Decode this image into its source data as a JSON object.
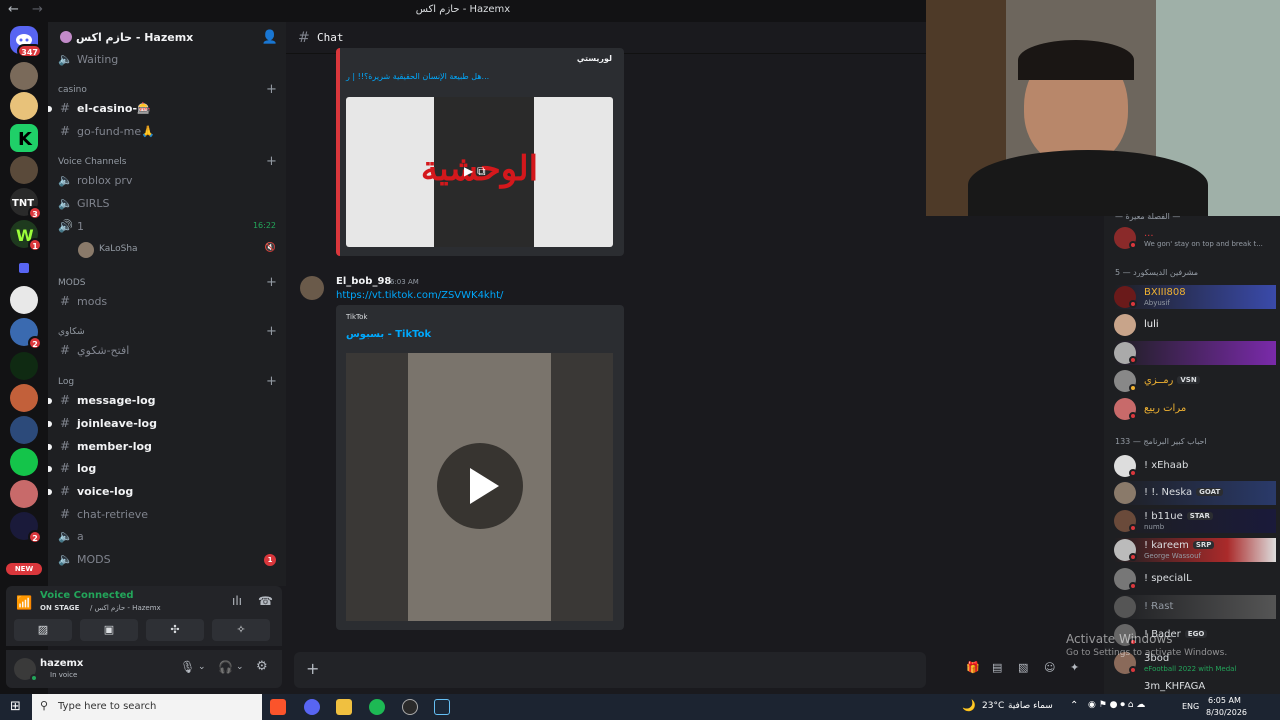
{
  "window": {
    "title": "حازم اكس - Hazemx"
  },
  "rail": {
    "home_badge": "347",
    "new_label": "NEW",
    "badges": [
      "3",
      "1",
      "2",
      "2"
    ]
  },
  "server": {
    "name": "حازم اكس - Hazemx"
  },
  "channels": {
    "waiting": "Waiting",
    "cat_casino": "casino",
    "el_casino": "el-casino-🎰",
    "go_fund": "go-fund-me🙏",
    "cat_voice": "Voice Channels",
    "roblox": "roblox prv",
    "girls": "GIRLS",
    "one": "1",
    "one_time": "16:22",
    "voice_user": "KaLoSha",
    "cat_mods": "MODS",
    "mods": "mods",
    "cat_shakawi": "شكاوي",
    "shakawi": "افتح-شكوي",
    "cat_log": "Log",
    "message_log": "message-log",
    "joinleave_log": "joinleave-log",
    "member_log": "member-log",
    "log": "log",
    "voice_log": "voice-log",
    "chat_retrieve": "chat-retrieve",
    "a": "a",
    "mods_voice": "MODS",
    "mods_voice_badge": "1"
  },
  "voice": {
    "status": "Voice Connected",
    "stage": "ON STAGE",
    "where": "/ حازم اكس - Hazemx"
  },
  "user": {
    "name": "hazemx",
    "status": "In voice"
  },
  "chat": {
    "channel": "Chat",
    "embed1": {
      "author": "لوريستي",
      "title": "هل طبيعة الإنسان الحقيقية شريرة؟!! | ر...",
      "thumb_text": "الوحشية"
    },
    "msg2": {
      "author": "El_bob_98",
      "time": "6:03 AM",
      "link": "https://vt.tiktok.com/ZSVWK4kht/",
      "provider": "TikTok",
      "title": "بسبوس - TikTok"
    }
  },
  "members": {
    "group1": "— الفصلة معيرة —",
    "m0": {
      "name": "...",
      "sub": "We gon' stay on top and break t..."
    },
    "group2": "مشرفين الديسكورد — 5",
    "m1": {
      "name": "BXIII808",
      "sub": "Abyusif"
    },
    "m2": {
      "name": "luli"
    },
    "m3": {
      "name": ""
    },
    "m4": {
      "name": "رمــزي",
      "tag": "VSN"
    },
    "m5": {
      "name": "مرات رييع"
    },
    "group3": "احباب كبير البرنامج — 133",
    "m6": {
      "name": "! xEhaab"
    },
    "m7": {
      "name": "! !. Neska",
      "tag": "GOAT"
    },
    "m8": {
      "name": "! b11ue",
      "tag": "STAR",
      "sub": "numb"
    },
    "m9": {
      "name": "! kareem",
      "tag": "SRP",
      "sub": "George Wassouf"
    },
    "m10": {
      "name": "! specialL"
    },
    "m11": {
      "name": "! Ɍast"
    },
    "m12": {
      "name": "! Bader",
      "tag": "EGO"
    },
    "m13": {
      "name": "3bod",
      "sub": "eFootball 2022 with Medal"
    },
    "m14": {
      "name": "3m_KHFAGA"
    }
  },
  "watermark": {
    "line1": "Activate Windows",
    "line2": "Go to Settings to activate Windows."
  },
  "taskbar": {
    "search_placeholder": "Type here to search",
    "weather": "23°C",
    "weather_desc": "سماء صافية",
    "lang": "ENG",
    "time": "6:05 AM",
    "date": "8/30/2026"
  },
  "colors": {
    "accent": "#5865f2",
    "online": "#23a55a",
    "dnd": "#da373c",
    "idle": "#f0b232",
    "link": "#00a8fc"
  }
}
